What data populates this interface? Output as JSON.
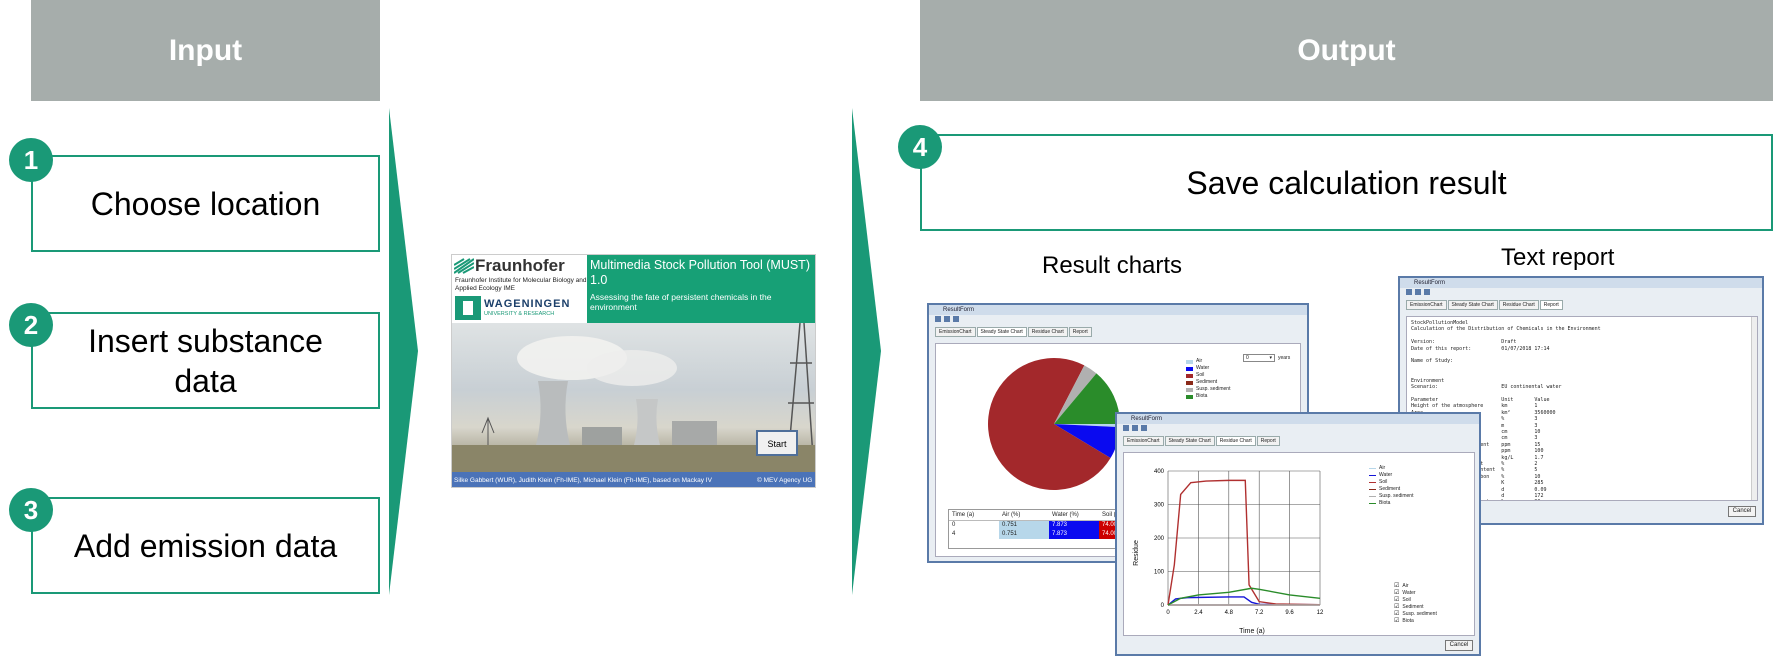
{
  "headers": {
    "input": "Input",
    "output": "Output"
  },
  "steps": [
    {
      "number": "1",
      "label": "Choose location"
    },
    {
      "number": "2",
      "label": "Insert substance data"
    },
    {
      "number": "3",
      "label": "Add emission data"
    },
    {
      "number": "4",
      "label": "Save calculation result"
    }
  ],
  "captions": {
    "charts": "Result charts",
    "report": "Text report"
  },
  "splash": {
    "fraunhofer": "Fraunhofer",
    "fraunhofer_sub": "Fraunhofer Institute for Molecular Biology and Applied Ecology IME",
    "wageningen": "WAGENINGEN",
    "wageningen_sub": "UNIVERSITY & RESEARCH",
    "title": "Multimedia Stock Pollution Tool (MUST) 1.0",
    "subtitle": "Assessing the fate of persistent chemicals in the environment",
    "start_button": "Start",
    "credits": "Silke Gabbert (WUR), Judith Klein (Fh-IME), Michael Klein (Fh-IME), based on Mackay IV",
    "copyright": "© MEV Agency UG"
  },
  "window_title": "ResultForm",
  "tabs": [
    "EmissionChart",
    "Steady State Chart",
    "Residue Chart",
    "Report"
  ],
  "steady_chart": {
    "dropdown_value": "0",
    "dropdown_unit": "years",
    "table_headers": [
      "Time (a)",
      "Air (%)",
      "Water (%)",
      "Soil (%"
    ],
    "table_rows": [
      [
        "0",
        "0.751",
        "7.873",
        "74.000"
      ],
      [
        "4",
        "0.751",
        "7.873",
        "74.000"
      ]
    ]
  },
  "residue_chart_labels": {
    "ylabel": "Residue",
    "xlabel": "Time (a)",
    "yticks": [
      "0",
      "100",
      "200",
      "300",
      "400"
    ],
    "xticks": [
      "0",
      "2.4",
      "4.8",
      "7.2",
      "9.6",
      "12"
    ],
    "checkboxes": [
      "Air",
      "Water",
      "Soil",
      "Sediment",
      "Susp. sediment",
      "Biota"
    ],
    "cancel": "Cancel"
  },
  "report": {
    "cancel": "Cancel",
    "text": "StockPollutionModel\nCalculation of the Distribution of Chemicals in the Environment\n\nVersion:                      Draft\nDate of this report:          01/07/2018 17:14\n\nName of Study:\n\n\nEnvironment\nScenario:                     EU continental water\n\nParameter                     Unit       Value\nHeight of the atmosphere      km         1\nArea                          km²        3560000\nWater fraction                %          3\nWater depth                   m          3\nSoil depth                    cm         10\nSediment depth                cm         3\nFraction of susp. sediment    ppm        15\nFraction of biota             ppm        100\nSoil density                  kg/L       1.7\nSoil org. carbon content      %          2\nSediment org. carbon content  %          5\nSusp. sediment org. carbon    %          10\nTemperature                   K          285\nResidence time air            d          0.09\nResidence time water          d          172\nAverage connection percentage %          90"
  },
  "chart_data": [
    {
      "type": "pie",
      "series": [
        {
          "name": "Air",
          "value": 0.751,
          "color": "#b7d7ea"
        },
        {
          "name": "Water",
          "value": 7.873,
          "color": "#0a0af0"
        },
        {
          "name": "Soil",
          "value": 74.0,
          "color": "#a3282b"
        },
        {
          "name": "Sediment",
          "value": 0,
          "color": "#8b2a1a"
        },
        {
          "name": "Susp. sediment",
          "value": 3.5,
          "color": "#b0b0b0"
        },
        {
          "name": "Biota",
          "value": 13.9,
          "color": "#2a8c2a"
        }
      ]
    },
    {
      "type": "line",
      "xlabel": "Time (a)",
      "ylabel": "Residue",
      "xlim": [
        0,
        12
      ],
      "ylim": [
        0,
        400
      ],
      "series": [
        {
          "name": "Air",
          "color": "#b7d7ea",
          "x": [
            0,
            12
          ],
          "y": [
            0,
            0
          ]
        },
        {
          "name": "Water",
          "color": "#1515d8",
          "x": [
            0,
            0.6,
            1.5,
            4.8,
            6.0,
            6.6,
            7.2,
            12
          ],
          "y": [
            0,
            18,
            22,
            24,
            24,
            8,
            2,
            1
          ]
        },
        {
          "name": "Soil",
          "color": "#b03030",
          "x": [
            0,
            0.5,
            1.0,
            1.8,
            3.0,
            4.8,
            6.1,
            6.4,
            7.2,
            8.5,
            12
          ],
          "y": [
            0,
            120,
            330,
            365,
            370,
            372,
            372,
            60,
            10,
            3,
            1
          ]
        },
        {
          "name": "Sediment",
          "color": "#8b2a1a",
          "x": [
            0,
            12
          ],
          "y": [
            0,
            0
          ]
        },
        {
          "name": "Susp. sediment",
          "color": "#b0b0b0",
          "x": [
            0,
            12
          ],
          "y": [
            0,
            0
          ]
        },
        {
          "name": "Biota",
          "color": "#2a8c2a",
          "x": [
            0,
            1.0,
            2.4,
            4.8,
            6.6,
            7.2,
            9.6,
            12
          ],
          "y": [
            0,
            20,
            30,
            38,
            50,
            47,
            30,
            20
          ]
        }
      ]
    }
  ]
}
